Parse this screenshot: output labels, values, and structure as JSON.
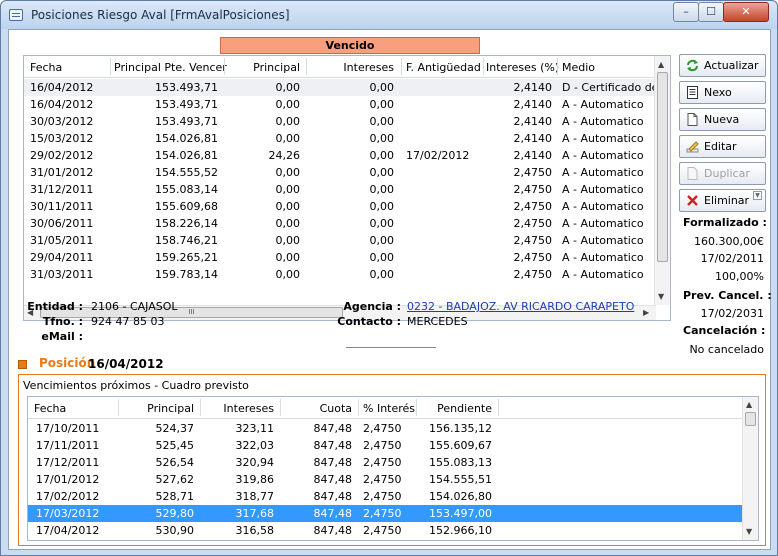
{
  "window": {
    "title": "Posiciones Riesgo Aval [FrmAvalPosiciones]",
    "min": "–",
    "max": "☐",
    "close": "✕"
  },
  "vencido_label": "Vencido",
  "grid1": {
    "headers": [
      "Fecha",
      "Principal Pte. Vencer",
      "Principal",
      "Intereses",
      "F. Antigüedad",
      "Intereses (%)",
      "Medio"
    ],
    "rows": [
      [
        "16/04/2012",
        "153.493,71",
        "0,00",
        "0,00",
        "",
        "2,4140",
        "D - Certificado deu..."
      ],
      [
        "16/04/2012",
        "153.493,71",
        "0,00",
        "0,00",
        "",
        "2,4140",
        "A - Automatico"
      ],
      [
        "30/03/2012",
        "153.493,71",
        "0,00",
        "0,00",
        "",
        "2,4140",
        "A - Automatico"
      ],
      [
        "15/03/2012",
        "154.026,81",
        "0,00",
        "0,00",
        "",
        "2,4140",
        "A - Automatico"
      ],
      [
        "29/02/2012",
        "154.026,81",
        "24,26",
        "0,00",
        "17/02/2012",
        "2,4140",
        "A - Automatico"
      ],
      [
        "31/01/2012",
        "154.555,52",
        "0,00",
        "0,00",
        "",
        "2,4750",
        "A - Automatico"
      ],
      [
        "31/12/2011",
        "155.083,14",
        "0,00",
        "0,00",
        "",
        "2,4750",
        "A - Automatico"
      ],
      [
        "30/11/2011",
        "155.609,68",
        "0,00",
        "0,00",
        "",
        "2,4750",
        "A - Automatico"
      ],
      [
        "30/06/2011",
        "158.226,14",
        "0,00",
        "0,00",
        "",
        "2,4750",
        "A - Automatico"
      ],
      [
        "31/05/2011",
        "158.746,21",
        "0,00",
        "0,00",
        "",
        "2,4750",
        "A - Automatico"
      ],
      [
        "29/04/2011",
        "159.265,21",
        "0,00",
        "0,00",
        "",
        "2,4750",
        "A - Automatico"
      ],
      [
        "31/03/2011",
        "159.783,14",
        "0,00",
        "0,00",
        "",
        "2,4750",
        "A - Automatico"
      ]
    ],
    "hscroll_grip": "III"
  },
  "buttons": {
    "actualizar": "Actualizar",
    "nexo": "Nexo",
    "nueva": "Nueva",
    "editar": "Editar",
    "duplicar": "Duplicar",
    "eliminar": "Eliminar"
  },
  "sidebar": {
    "formalizado_label": "Formalizado :",
    "importe": "160.300,00€",
    "fecha_form": "17/02/2011",
    "porcentaje": "100,00%",
    "prev_cancel_label": "Prev. Cancel. :",
    "prev_cancel": "17/02/2031",
    "cancelacion_label": "Cancelación :",
    "cancelacion": "No cancelado"
  },
  "entity": {
    "entidad_label": "Entidad :",
    "entidad": "2106 - CAJASOL",
    "tfno_label": "Tfno. :",
    "tfno": "924 47 85 03",
    "email_label": "eMail :",
    "agencia_label": "Agencia :",
    "agencia": "0232 - BADAJOZ. AV RICARDO CARAPETO",
    "contacto_label": "Contacto :",
    "contacto": "MERCEDES"
  },
  "posicion": {
    "label": "Posición",
    "date": "16/04/2012"
  },
  "group_title": "Vencimientos próximos - Cuadro previsto",
  "grid2": {
    "headers": [
      "Fecha",
      "Principal",
      "Intereses",
      "Cuota",
      "% Interés",
      "Pendiente"
    ],
    "rows": [
      [
        "17/10/2011",
        "524,37",
        "323,11",
        "847,48",
        "2,4750",
        "156.135,12"
      ],
      [
        "17/11/2011",
        "525,45",
        "322,03",
        "847,48",
        "2,4750",
        "155.609,67"
      ],
      [
        "17/12/2011",
        "526,54",
        "320,94",
        "847,48",
        "2,4750",
        "155.083,13"
      ],
      [
        "17/01/2012",
        "527,62",
        "319,86",
        "847,48",
        "2,4750",
        "154.555,51"
      ],
      [
        "17/02/2012",
        "528,71",
        "318,77",
        "847,48",
        "2,4750",
        "154.026,80"
      ],
      [
        "17/03/2012",
        "529,80",
        "317,68",
        "847,48",
        "2,4750",
        "153.497,00"
      ],
      [
        "17/04/2012",
        "530,90",
        "316,58",
        "847,48",
        "2,4750",
        "152.966,10"
      ]
    ],
    "selected_index": 5
  }
}
